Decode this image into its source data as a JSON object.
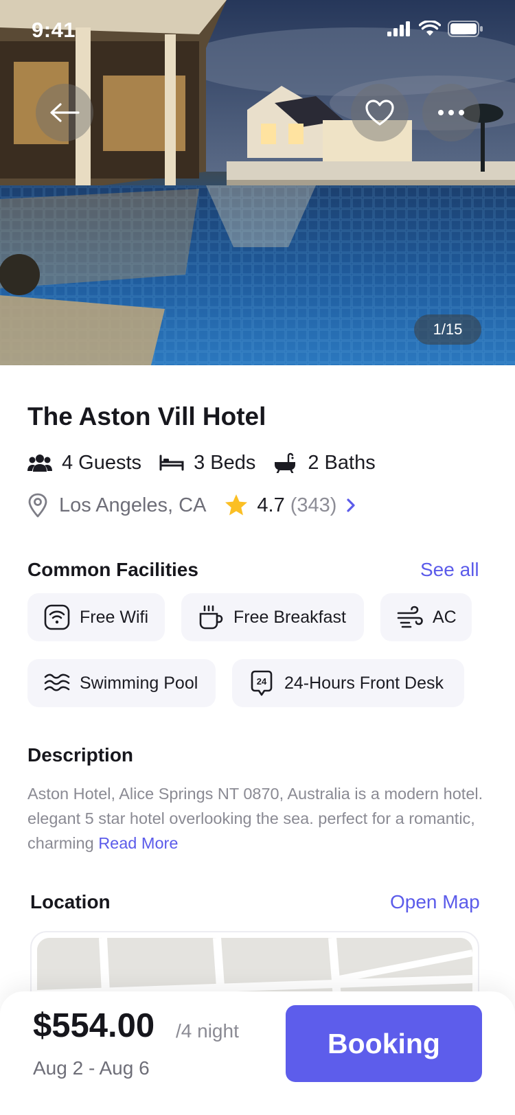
{
  "status": {
    "time": "9:41"
  },
  "gallery": {
    "counter": "1/15"
  },
  "hotel": {
    "name": "The Aston Vill Hotel",
    "guests": "4 Guests",
    "beds": "3 Beds",
    "baths": "2 Baths",
    "location": "Los Angeles, CA",
    "rating": "4.7",
    "reviews": "(343)"
  },
  "facilities": {
    "title": "Common Facilities",
    "see_all": "See all",
    "items": [
      {
        "label": "Free Wifi",
        "icon": "wifi-icon"
      },
      {
        "label": "Free Breakfast",
        "icon": "coffee-cup-icon"
      },
      {
        "label": "AC",
        "icon": "wind-icon"
      },
      {
        "label": "Swimming Pool",
        "icon": "waves-icon"
      },
      {
        "label": "24-Hours Front Desk",
        "icon": "clock-24-icon"
      }
    ]
  },
  "description": {
    "title": "Description",
    "text": "Aston Hotel, Alice Springs NT 0870, Australia is a modern hotel. elegant 5 star hotel overlooking the sea. perfect for a romantic, charming ",
    "read_more": "Read More"
  },
  "location_section": {
    "title": "Location",
    "open_map": "Open Map"
  },
  "booking": {
    "price": "$554.00",
    "per_night": "/4 night",
    "dates": "Aug 2 - Aug 6",
    "button": "Booking"
  },
  "colors": {
    "accent": "#5d5deb",
    "star": "#fbbf24",
    "chip_bg": "#f5f5fa"
  }
}
